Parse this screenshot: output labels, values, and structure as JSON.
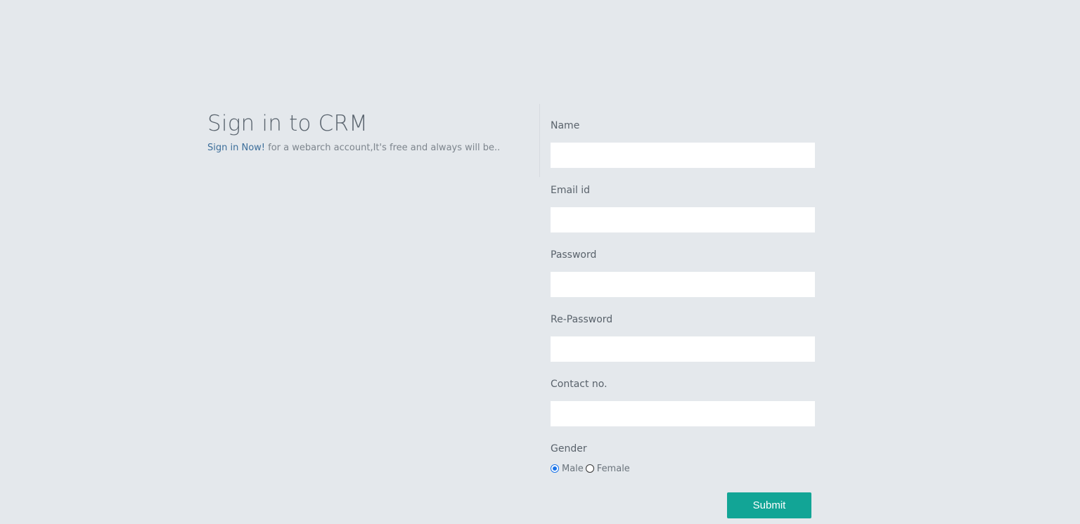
{
  "header": {
    "title": "Sign in to CRM",
    "subtitle_link": "Sign in Now!",
    "subtitle_text": " for a webarch account,It's free and always will be.."
  },
  "form": {
    "fields": [
      {
        "label": "Name",
        "value": "",
        "placeholder": ""
      },
      {
        "label": "Email id",
        "value": "",
        "placeholder": ""
      },
      {
        "label": "Password",
        "value": "",
        "placeholder": ""
      },
      {
        "label": "Re-Password",
        "value": "",
        "placeholder": ""
      },
      {
        "label": "Contact no.",
        "value": "",
        "placeholder": ""
      }
    ],
    "gender": {
      "label": "Gender",
      "options": [
        "Male",
        "Female"
      ],
      "selected": "Male"
    },
    "submit_label": "Submit"
  },
  "colors": {
    "background": "#e4e8ec",
    "accent": "#12a596",
    "link": "#3c6e9a",
    "radio_selected": "#1a73e8"
  }
}
